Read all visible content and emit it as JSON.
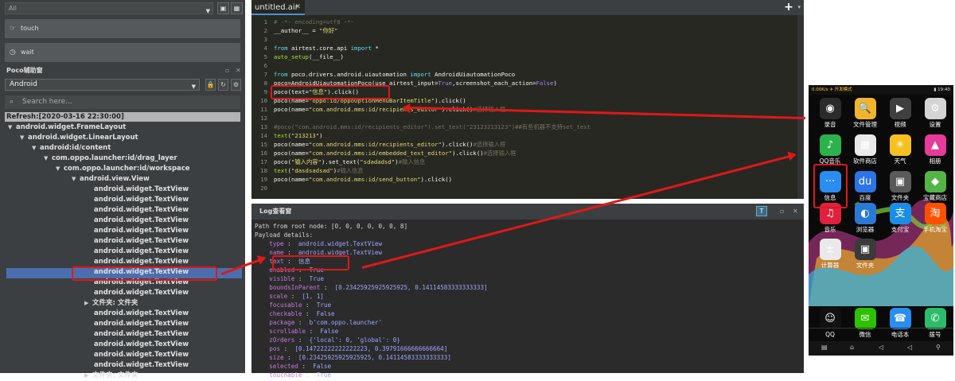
{
  "left_panel": {
    "filter_value": "All",
    "actions": [
      {
        "label": "touch",
        "icon": "hand-icon"
      },
      {
        "label": "wait",
        "icon": "clock-icon"
      }
    ],
    "poco_title": "Poco辅助窗",
    "platform_select": "Android",
    "search_placeholder": "Search here...",
    "refresh_label": "Refresh:[2020-03-16 22:30:00]",
    "tree": [
      "android.widget.FrameLayout",
      "android.widget.LinearLayout",
      "android:id/content",
      "com.oppo.launcher:id/drag_layer",
      "com.oppo.launcher:id/workspace",
      "android.view.View",
      "android.widget.TextView",
      "android.widget.TextView",
      "android.widget.TextView",
      "android.widget.TextView",
      "android.widget.TextView",
      "android.widget.TextView",
      "android.widget.TextView",
      "android.widget.TextView",
      "android.widget.TextView",
      "android.widget.TextView",
      "android.widget.TextView",
      "文件夹:  文件夹",
      "android.widget.TextView",
      "android.widget.TextView",
      "android.widget.TextView",
      "android.widget.TextView",
      "android.widget.TextView",
      "android.widget.TextView",
      "文件夹:  文件夹"
    ]
  },
  "editor": {
    "tab_label": "untitled.air",
    "close_glyph": "✕",
    "add_glyph": "+"
  },
  "code_lines": [
    "# -*- encoding=utf8 -*-",
    "__author__ = \"你好\"",
    "",
    "from airtest.core.api import *",
    "auto_setup(__file__)",
    "",
    "from poco.drivers.android.uiautomation import AndroidUiautomationPoco",
    "poco=AndroidUiautomationPoco(use_airtest_input=True,screenshot_each_action=False)",
    "poco(text=\"信息\").click()",
    "poco(name=\"oppo:id/oppoOptionMenuBarItemTitle\").click()",
    "poco(name=\"com.android.mms:id/recipients_editor\").click()#选择输入框",
    "",
    "#poco(\"com.android.mms:id/recipients_editor\").set_text(\"23123213123\")##有些机器不支持set_text",
    "text(\"213213\")",
    "poco(name=\"com.android.mms:id/recipients_editor\").click()#选择输入框",
    "poco(name=\"com.android.mms:id/embedded_text_editor\").click()#选择输入框",
    "poco(\"输入内容\").set_text(\"sdadadsd\")#输入信息",
    "text(\"dasdsadsad\")#输入信息",
    "poco(name=\"com.android.mms:id/send_button\").click()",
    ""
  ],
  "log_panel": {
    "title": "Log查看窗",
    "lines": [
      "Path from root node: [0, 0, 0, 0, 0, 0, 8]",
      "Payload details:",
      "    type :  android.widget.TextView",
      "    name :  android.widget.TextView",
      "    text :  信息",
      "    enabled :  True",
      "    visible :  True",
      "    boundsInParent :  [0.23425925925925925, 0.14114583333333333]",
      "    scale :  [1, 1]",
      "    focusable :  True",
      "    checkable :  False",
      "    package :  b'com.oppo.launcher'",
      "    scrollable :  False",
      "    zOrders :  {'local': 0, 'global': 0}",
      "    pos :  [0.14722222222222223, 0.39791666666666664]",
      "    size :  [0.23425925925925925, 0.14114583333333333]",
      "    selected :  False",
      "    touchable :  True"
    ]
  },
  "phone": {
    "status_left": "0.00K/s  ✈  开发模式",
    "status_right": "▮ 19:40",
    "apps": [
      {
        "label": "录音",
        "icon": "recorder-icon",
        "glyph": "◉",
        "color": "#2b2b2b"
      },
      {
        "label": "文件管理",
        "icon": "file-manager-icon",
        "glyph": "🔍",
        "color": "#f1b52b"
      },
      {
        "label": "视频",
        "icon": "video-icon",
        "glyph": "▶",
        "color": "#3f3f3f"
      },
      {
        "label": "设置",
        "icon": "settings-icon",
        "glyph": "⚙",
        "color": "#d4d4d4"
      },
      {
        "label": "QQ音乐",
        "icon": "qq-music-icon",
        "glyph": "♪",
        "color": "#2bb24c"
      },
      {
        "label": "软件商店",
        "icon": "app-store-icon",
        "glyph": "▦",
        "color": "#e9e9e9"
      },
      {
        "label": "天气",
        "icon": "weather-icon",
        "glyph": "☀",
        "color": "#f7c021"
      },
      {
        "label": "相册",
        "icon": "gallery-icon",
        "glyph": "▲",
        "color": "#e73a9b"
      },
      {
        "label": "信息",
        "icon": "message-icon",
        "glyph": "···",
        "color": "#2a8df1"
      },
      {
        "label": "百度",
        "icon": "baidu-icon",
        "glyph": "du",
        "color": "#2d74e6"
      },
      {
        "label": "文件夹",
        "icon": "folder-icon",
        "glyph": "▣",
        "color": "#5a5a5a"
      },
      {
        "label": "宝藏商店",
        "icon": "treasure-store-icon",
        "glyph": "◆",
        "color": "#53b548"
      },
      {
        "label": "音乐",
        "icon": "music-icon",
        "glyph": "♫",
        "color": "#e0213d"
      },
      {
        "label": "浏览器",
        "icon": "browser-icon",
        "glyph": "◐",
        "color": "#2b79d6"
      },
      {
        "label": "支付宝",
        "icon": "alipay-icon",
        "glyph": "支",
        "color": "#1a8ee6"
      },
      {
        "label": "手机淘宝",
        "icon": "taobao-icon",
        "glyph": "淘",
        "color": "#ff5000"
      },
      {
        "label": "计算器",
        "icon": "calculator-icon",
        "glyph": "±",
        "color": "#e9e9e9"
      },
      {
        "label": "文件夹",
        "icon": "folder-icon",
        "glyph": "▣",
        "color": "#3a3a3a"
      },
      {
        "label": "QQ",
        "icon": "qq-icon",
        "glyph": "☺",
        "color": "#111111"
      },
      {
        "label": "微信",
        "icon": "wechat-icon",
        "glyph": "✉",
        "color": "#2dc100"
      },
      {
        "label": "电话本",
        "icon": "contacts-icon",
        "glyph": "☎",
        "color": "#2a8df1"
      },
      {
        "label": "拨号",
        "icon": "dialer-icon",
        "glyph": "✆",
        "color": "#2dbc6a"
      }
    ],
    "nav": [
      "▤",
      "⌂",
      "◁",
      "◁",
      "⚲"
    ]
  }
}
